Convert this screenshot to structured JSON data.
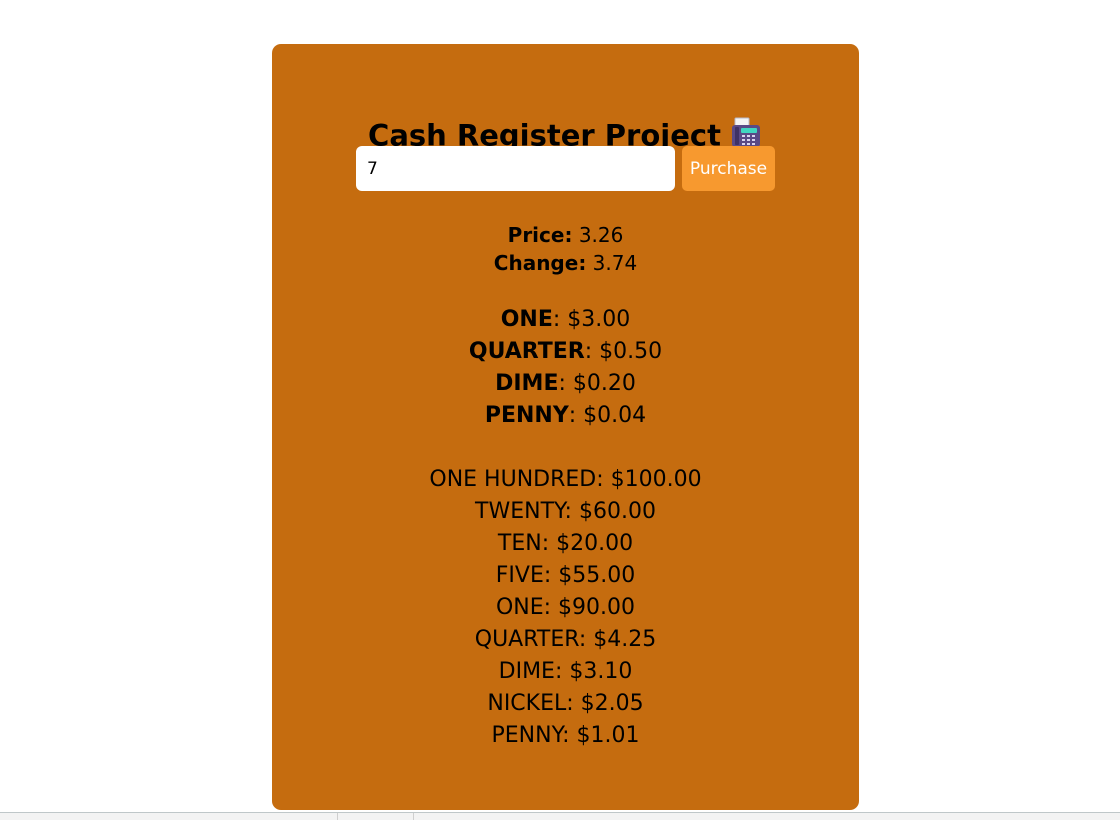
{
  "app": {
    "title": "Cash Register Project"
  },
  "form": {
    "cash_value": "7",
    "purchase_label": "Purchase"
  },
  "summary": {
    "price_label": "Price:",
    "price_value": "3.26",
    "change_label": "Change:",
    "change_value": "3.74"
  },
  "change_due": [
    {
      "name": "ONE",
      "amount": ": $3.00"
    },
    {
      "name": "QUARTER",
      "amount": ": $0.50"
    },
    {
      "name": "DIME",
      "amount": ": $0.20"
    },
    {
      "name": "PENNY",
      "amount": ": $0.04"
    }
  ],
  "drawer": [
    "ONE HUNDRED: $100.00",
    "TWENTY: $60.00",
    "TEN: $20.00",
    "FIVE: $55.00",
    "ONE: $90.00",
    "QUARTER: $4.25",
    "DIME: $3.10",
    "NICKEL: $2.05",
    "PENNY: $1.01"
  ],
  "icons": {
    "title_icon": "fax-machine-icon"
  },
  "colors": {
    "card_background": "#c56c0f",
    "purchase_button": "#f7992f",
    "page_background": "#ffffff"
  }
}
